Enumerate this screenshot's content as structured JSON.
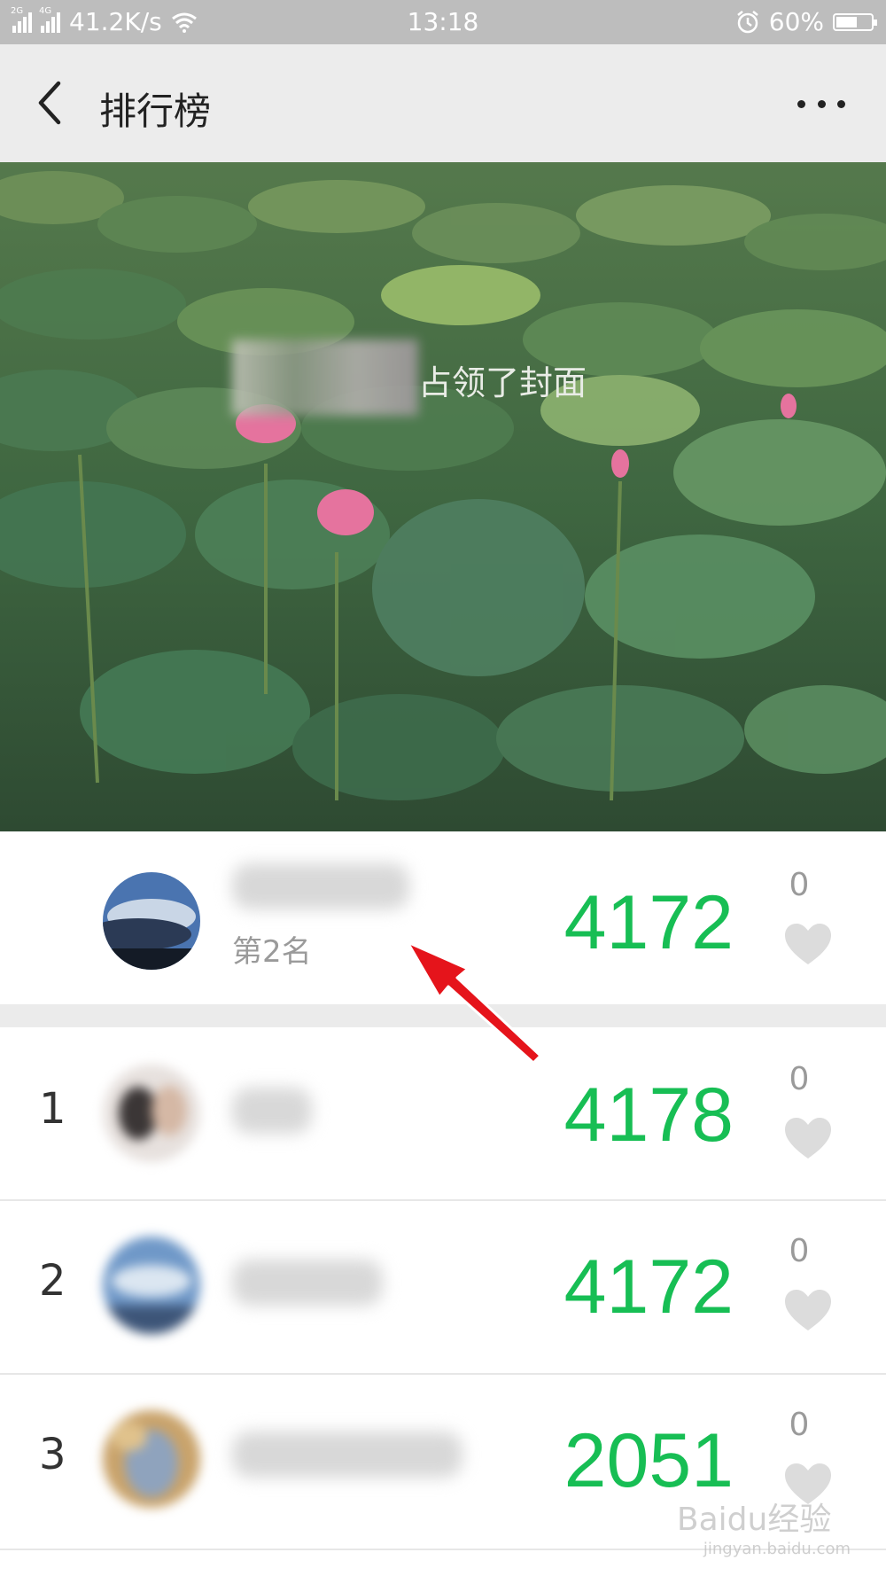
{
  "status_bar": {
    "network_1": "2G",
    "network_2": "4G",
    "speed": "41.2K/s",
    "time": "13:18",
    "battery": "60%",
    "battery_level": 0.6
  },
  "header": {
    "title": "排行榜",
    "back_icon": "chevron-left-icon",
    "more_icon": "more-dots-icon"
  },
  "cover": {
    "caption": "占领了封面"
  },
  "my_entry": {
    "rank_label": "第2名",
    "steps": "4172",
    "likes": "0"
  },
  "ranking": [
    {
      "rank": "1",
      "steps": "4178",
      "likes": "0"
    },
    {
      "rank": "2",
      "steps": "4172",
      "likes": "0"
    },
    {
      "rank": "3",
      "steps": "2051",
      "likes": "0"
    }
  ],
  "colors": {
    "step_green": "#17be54",
    "nav_bg": "#ececec",
    "status_bg": "#bdbdbd",
    "arrow_red": "#e5141b"
  },
  "watermark": {
    "brand": "Baidu经验",
    "url": "jingyan.baidu.com"
  }
}
